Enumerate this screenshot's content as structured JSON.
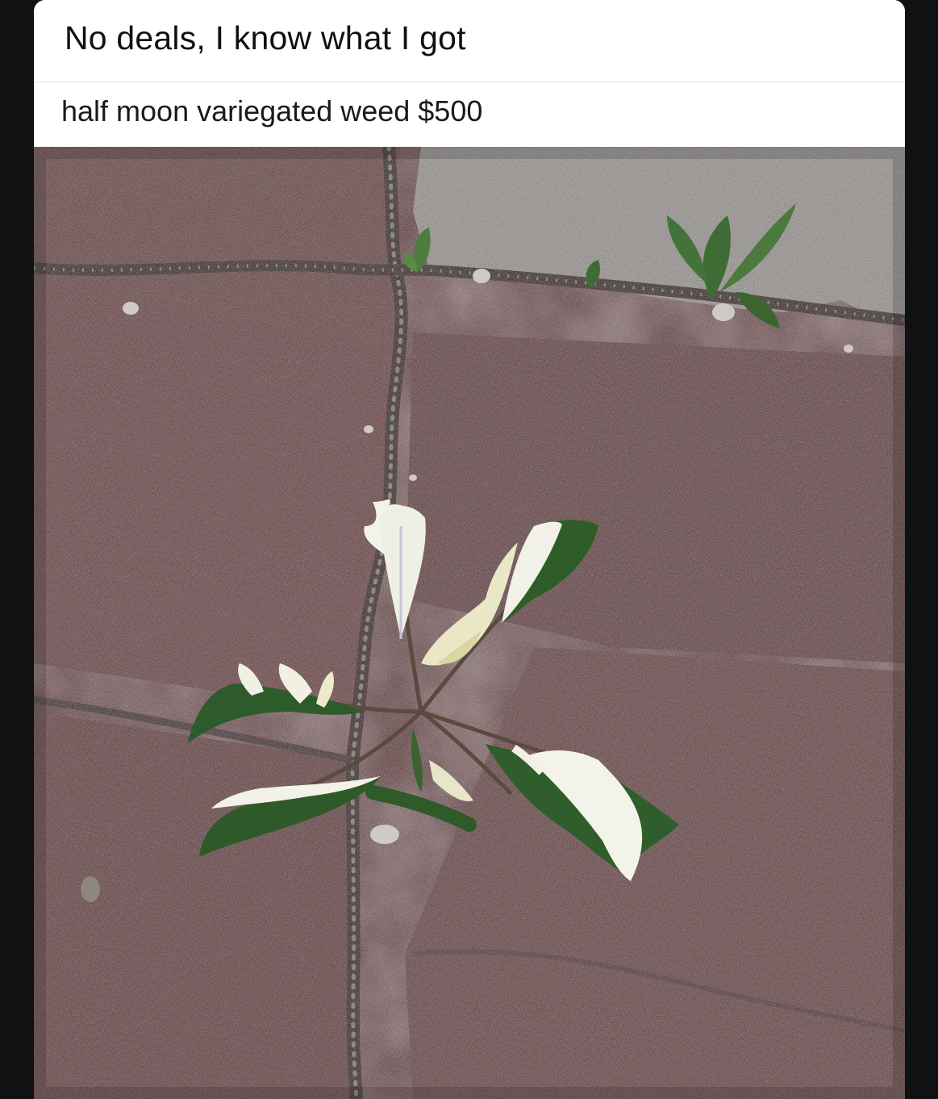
{
  "post": {
    "title": "No deals, I know what I got",
    "caption": "half moon variegated weed $500"
  },
  "photo": {
    "subject": "variegated-weed-in-pavement-crack"
  },
  "colors": {
    "page_background": "#0f1112",
    "card_background": "#ffffff",
    "brick": "#6f4b4d",
    "concrete": "#a9a9a7",
    "leaf_green": "#2f5a2a",
    "leaf_variegation": "#f2f1e6"
  }
}
